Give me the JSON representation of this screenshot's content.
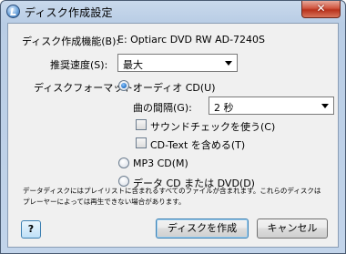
{
  "window": {
    "title": "ディスク作成設定",
    "close_label": "✕"
  },
  "device": {
    "label": "ディスク作成機能(B):",
    "value": "E: Optiarc DVD RW AD-7240S"
  },
  "speed": {
    "label": "推奨速度(S):",
    "value": "最大"
  },
  "format": {
    "label": "ディスクフォーマット:",
    "audio_cd_label": "オーディオ CD(U)",
    "audio_cd_checked": true,
    "gap_label": "曲の間隔(G):",
    "gap_value": "2 秒",
    "sound_check_label": "サウンドチェックを使う(C)",
    "cd_text_label": "CD-Text を含める(T)",
    "mp3_cd_label": "MP3 CD(M)",
    "data_cd_label": "データ CD または DVD(D)"
  },
  "note": "データディスクにはプレイリストに含まれるすべてのファイルが含まれます。これらのディスクはプレーヤーによっては再生できない場合があります。",
  "buttons": {
    "help": "?",
    "burn": "ディスクを作成",
    "cancel": "キャンセル"
  }
}
